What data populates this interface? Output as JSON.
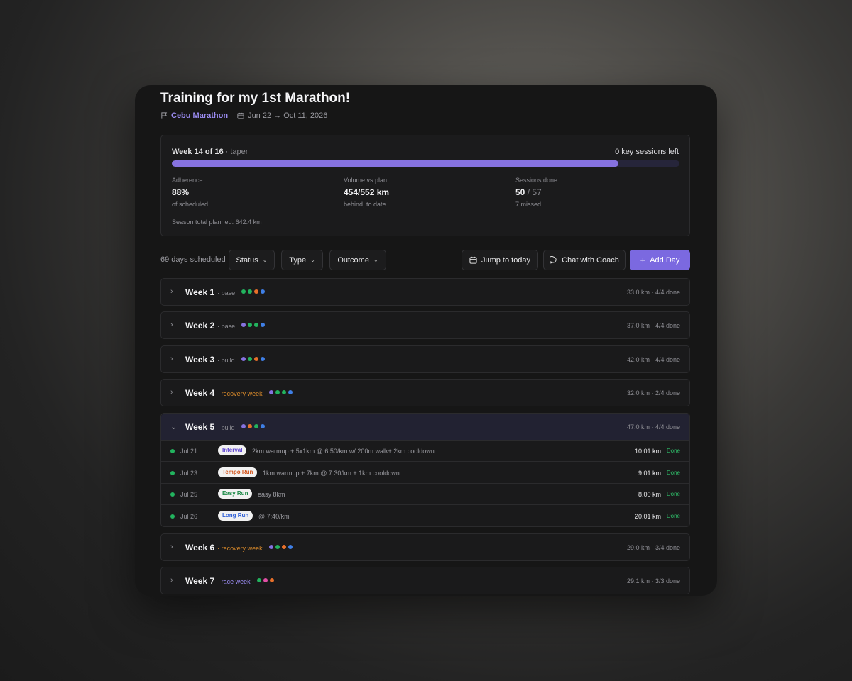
{
  "page": {
    "title": "Training for my 1st Marathon!",
    "race_name": "Cebu Marathon",
    "date_range": "Jun 22 → Oct 11, 2026"
  },
  "summary": {
    "week_label": "Week 14 of 16",
    "week_phase": "· taper",
    "key_sessions_left": "0 key sessions left",
    "progress_fraction": 0.88,
    "adherence": {
      "label": "Adherence",
      "value": "88%",
      "sub": "of scheduled"
    },
    "volume": {
      "label": "Volume vs plan",
      "value": "454/552 km",
      "sub": "behind, to date"
    },
    "sessions": {
      "label": "Sessions done",
      "value": "50",
      "total": "/ 57",
      "sub": "7 missed"
    },
    "season_total": "Season total planned: 642.4 km"
  },
  "toolbar": {
    "scheduled": "69 days scheduled",
    "status_filter": "Status",
    "type_filter": "Type",
    "outcome_filter": "Outcome",
    "jump_today": "Jump to today",
    "chat_coach": "Chat with Coach",
    "add_day": "Add Day"
  },
  "colors": {
    "accent": "#7b69e0",
    "green": "#22b35e",
    "purple": "#8672e0",
    "orange": "#e8702a",
    "blue": "#3f7fe6",
    "pink": "#e14fa6",
    "recovery": "#d98a2b",
    "race": "#9b8cf2"
  },
  "weeks": [
    {
      "title": "Week 1",
      "phase": "· base",
      "phase_color": "#8e8e94",
      "dots": [
        "#22b35e",
        "#22b35e",
        "#e8702a",
        "#3f7fe6"
      ],
      "stats": "33.0 km · 4/4 done"
    },
    {
      "title": "Week 2",
      "phase": "· base",
      "phase_color": "#8e8e94",
      "dots": [
        "#8672e0",
        "#22b35e",
        "#22b35e",
        "#3f7fe6"
      ],
      "stats": "37.0 km · 4/4 done"
    },
    {
      "title": "Week 3",
      "phase": "· build",
      "phase_color": "#8e8e94",
      "dots": [
        "#8672e0",
        "#22b35e",
        "#e8702a",
        "#3f7fe6"
      ],
      "stats": "42.0 km · 4/4 done"
    },
    {
      "title": "Week 4",
      "phase": "· recovery week",
      "phase_color": "#d98a2b",
      "dots": [
        "#8672e0",
        "#22b35e",
        "#22b35e",
        "#3f7fe6"
      ],
      "stats": "32.0 km · 2/4 done"
    },
    {
      "title": "Week 5",
      "phase": "· build",
      "phase_color": "#8e8e94",
      "dots": [
        "#8672e0",
        "#e8702a",
        "#22b35e",
        "#3f7fe6"
      ],
      "stats": "47.0 km · 4/4 done"
    },
    {
      "title": "Week 6",
      "phase": "· recovery week",
      "phase_color": "#d98a2b",
      "dots": [
        "#8672e0",
        "#22b35e",
        "#e8702a",
        "#3f7fe6"
      ],
      "stats": "29.0 km · 3/4 done"
    },
    {
      "title": "Week 7",
      "phase": "· race week",
      "phase_color": "#9b8cf2",
      "dots": [
        "#22b35e",
        "#e14fa6",
        "#e8702a"
      ],
      "stats": "29.1 km · 3/3 done"
    }
  ],
  "week5_sessions": [
    {
      "date": "Jul 21",
      "type": "Interval",
      "type_color": "#5a3fd0",
      "desc": "2km warmup + 5x1km @ 6:50/km w/ 200m walk+ 2km cooldown",
      "distance": "10.01 km",
      "status": "Done"
    },
    {
      "date": "Jul 23",
      "type": "Tempo Run",
      "type_color": "#d2541c",
      "desc": "1km warmup + 7km @ 7:30/km + 1km cooldown",
      "distance": "9.01 km",
      "status": "Done"
    },
    {
      "date": "Jul 25",
      "type": "Easy Run",
      "type_color": "#1e8a48",
      "desc": "easy 8km",
      "distance": "8.00 km",
      "status": "Done"
    },
    {
      "date": "Jul 26",
      "type": "Long Run",
      "type_color": "#2f5fd6",
      "desc": "@ 7:40/km",
      "distance": "20.01 km",
      "status": "Done"
    }
  ]
}
